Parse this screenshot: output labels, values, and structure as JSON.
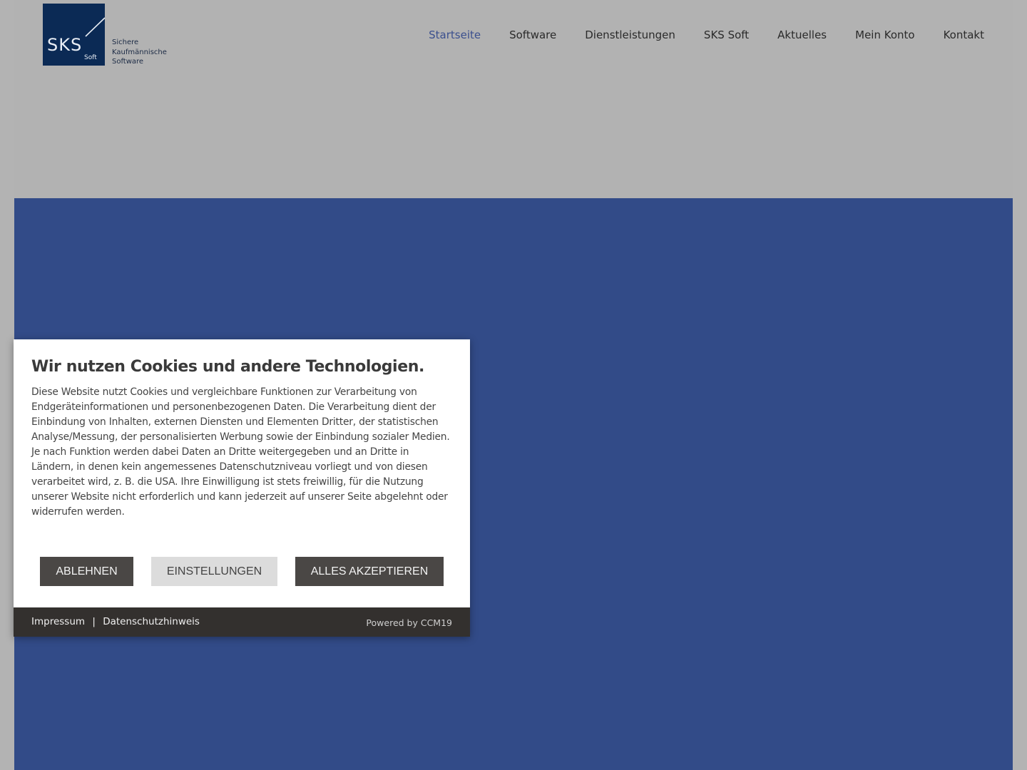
{
  "header": {
    "logo": {
      "mark": "SKS",
      "mark_sub": "Soft",
      "tagline": [
        "Sichere",
        "Kaufmännische",
        "Software"
      ]
    },
    "nav": [
      {
        "label": "Startseite",
        "active": true
      },
      {
        "label": "Software",
        "active": false
      },
      {
        "label": "Dienstleistungen",
        "active": false
      },
      {
        "label": "SKS Soft",
        "active": false
      },
      {
        "label": "Aktuelles",
        "active": false
      },
      {
        "label": "Mein Konto",
        "active": false
      },
      {
        "label": "Kontakt",
        "active": false
      }
    ]
  },
  "cookie_banner": {
    "title": "Wir nutzen Cookies und andere Technologien.",
    "text": "Diese Website nutzt Cookies und vergleichbare Funktionen zur Verarbeitung von Endgeräteinformationen und personenbezogenen Daten. Die Verarbeitung dient der Einbindung von Inhalten, externen Diensten und Elementen Dritter, der statistischen Analyse/Messung, der personalisierten Werbung sowie der Einbindung sozialer Medien. Je nach Funktion werden dabei Daten an Dritte weitergegeben und an Dritte in Ländern, in denen kein angemessenes Datenschutzniveau vorliegt und von diesen verarbeitet wird, z. B. die USA. Ihre Einwilligung ist stets freiwillig, für die Nutzung unserer Website nicht erforderlich und kann jederzeit auf unserer Seite abgelehnt oder widerrufen werden.",
    "buttons": {
      "reject": "ABLEHNEN",
      "settings": "EINSTELLUNGEN",
      "accept": "ALLES AKZEPTIEREN"
    },
    "footer": {
      "imprint": "Impressum",
      "separator": "|",
      "privacy": "Datenschutzhinweis",
      "powered_by": "Powered by CCM19"
    }
  },
  "colors": {
    "header_bg": "#b2b2b2",
    "hero_bg": "#324b88",
    "logo_bg": "#0b2a55",
    "nav_active": "#3a4f8e",
    "button_dark": "#4a4745",
    "button_light": "#dcdcdc",
    "cookie_footer_bg": "#33302e"
  }
}
